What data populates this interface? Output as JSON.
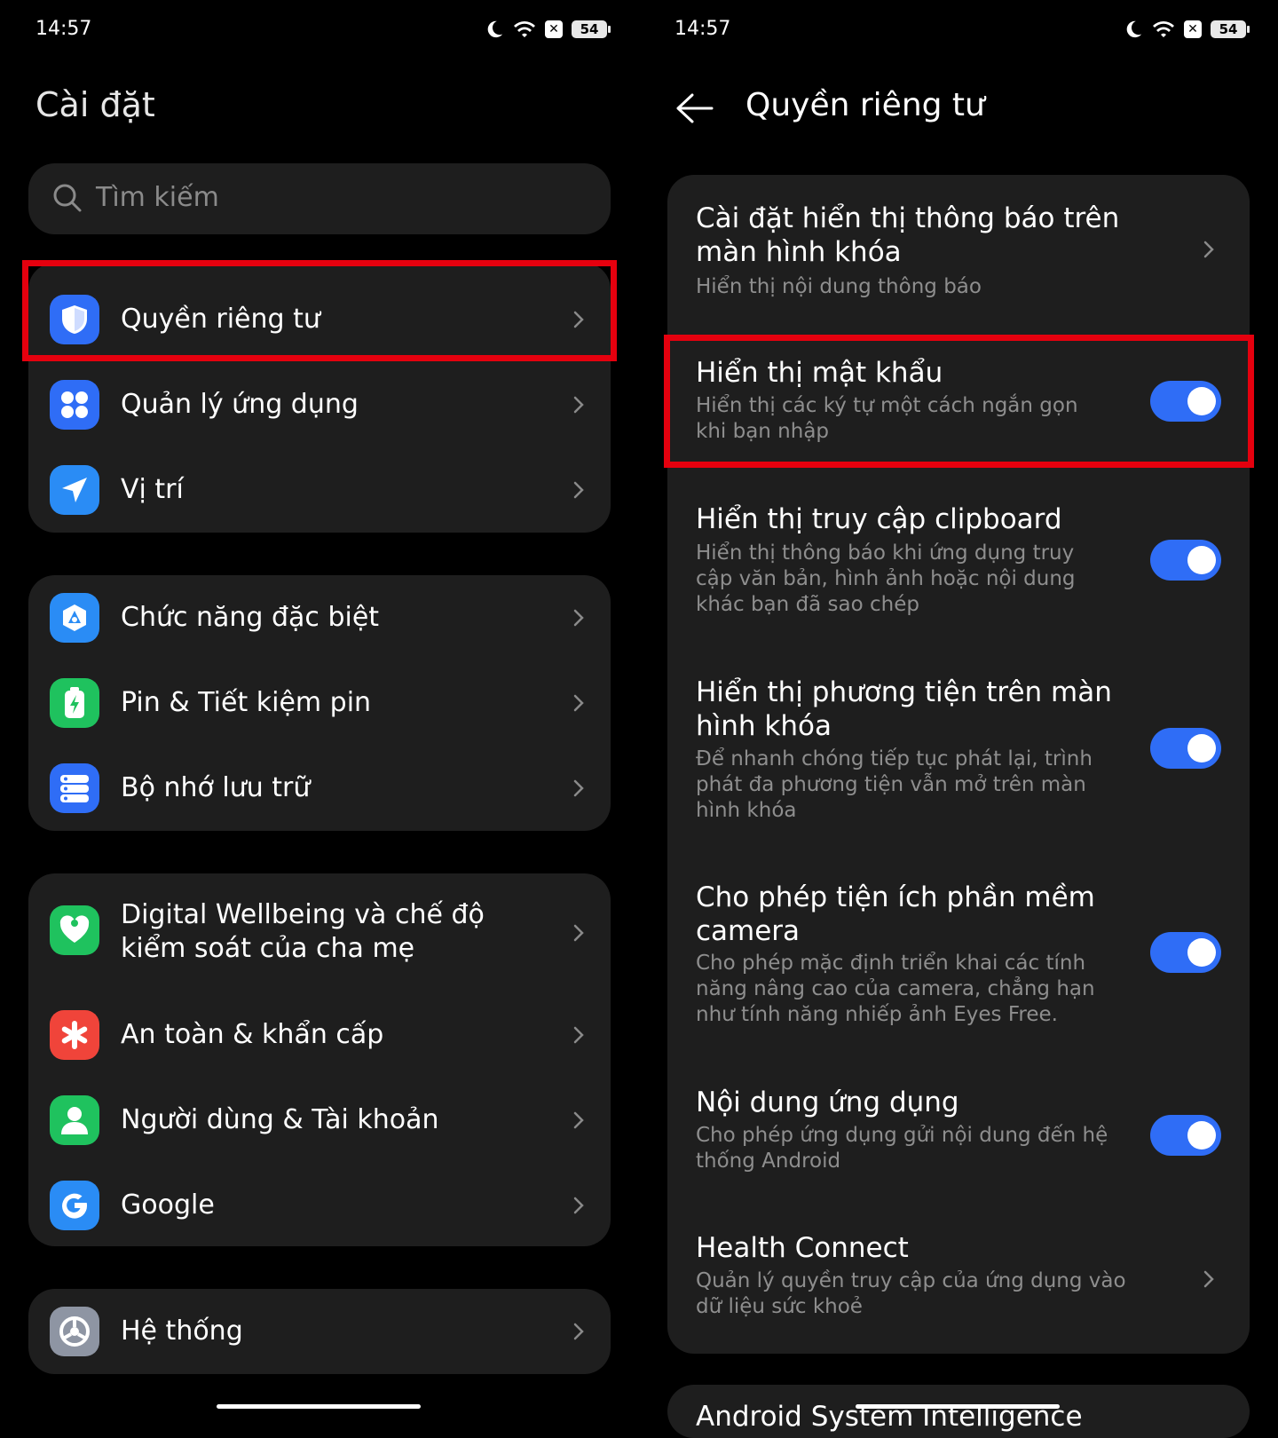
{
  "status_bar": {
    "time": "14:57",
    "battery": "54"
  },
  "left": {
    "title": "Cài đặt",
    "search_placeholder": "Tìm kiếm",
    "groups": [
      {
        "items": [
          {
            "label": "Quyền riêng tư",
            "icon": "privacy-shield-icon",
            "color": "#2f6df6"
          },
          {
            "label": "Quản lý ứng dụng",
            "icon": "apps-grid-icon",
            "color": "#2f6df6"
          },
          {
            "label": "Vị trí",
            "icon": "location-arrow-icon",
            "color": "#2a8cf5"
          }
        ]
      },
      {
        "items": [
          {
            "label": "Chức năng đặc biệt",
            "icon": "special-features-icon",
            "color": "#2a8cf5"
          },
          {
            "label": "Pin & Tiết kiệm pin",
            "icon": "battery-saver-icon",
            "color": "#1fc25e"
          },
          {
            "label": "Bộ nhớ lưu trữ",
            "icon": "storage-icon",
            "color": "#2f6df6"
          }
        ]
      },
      {
        "items": [
          {
            "label": "Digital Wellbeing và chế độ kiểm soát của cha mẹ",
            "icon": "wellbeing-heart-icon",
            "color": "#1fc25e"
          },
          {
            "label": "An toàn & khẩn cấp",
            "icon": "emergency-asterisk-icon",
            "color": "#f0443a"
          },
          {
            "label": "Người dùng & Tài khoản",
            "icon": "user-account-icon",
            "color": "#1fc25e"
          },
          {
            "label": "Google",
            "icon": "google-g-icon",
            "color": "#2a8cf5"
          }
        ]
      },
      {
        "items": [
          {
            "label": "Hệ thống",
            "icon": "system-gear-icon",
            "color": "#8e95a3"
          }
        ]
      }
    ]
  },
  "right": {
    "title": "Quyền riêng tư",
    "items": [
      {
        "title": "Cài đặt hiển thị thông báo trên màn hình khóa",
        "subtitle": "Hiển thị nội dung thông báo",
        "control": "chevron"
      },
      {
        "title": "Hiển thị mật khẩu",
        "subtitle": "Hiển thị các ký tự một cách ngắn gọn khi bạn nhập",
        "control": "toggle",
        "on": true
      },
      {
        "title": "Hiển thị truy cập clipboard",
        "subtitle": "Hiển thị thông báo khi ứng dụng truy cập văn bản, hình ảnh hoặc nội dung khác bạn đã sao chép",
        "control": "toggle",
        "on": true
      },
      {
        "title": "Hiển thị phương tiện trên màn hình khóa",
        "subtitle": "Để nhanh chóng tiếp tục phát lại, trình phát đa phương tiện vẫn mở trên màn hình khóa",
        "control": "toggle",
        "on": true
      },
      {
        "title": "Cho phép tiện ích phần mềm camera",
        "subtitle": "Cho phép mặc định triển khai các tính năng nâng cao của camera, chẳng hạn như tính năng nhiếp ảnh Eyes Free.",
        "control": "toggle",
        "on": true
      },
      {
        "title": "Nội dung ứng dụng",
        "subtitle": "Cho phép ứng dụng gửi nội dung đến hệ thống Android",
        "control": "toggle",
        "on": true
      },
      {
        "title": "Health Connect",
        "subtitle": "Quản lý quyền truy cập của ứng dụng vào dữ liệu sức khoẻ",
        "control": "chevron"
      }
    ],
    "next_group_peek": "Android System Intelligence"
  },
  "colors": {
    "accent": "#2f6df6",
    "highlight": "#e5000e",
    "card": "#1e1e1e",
    "background": "#000000"
  }
}
